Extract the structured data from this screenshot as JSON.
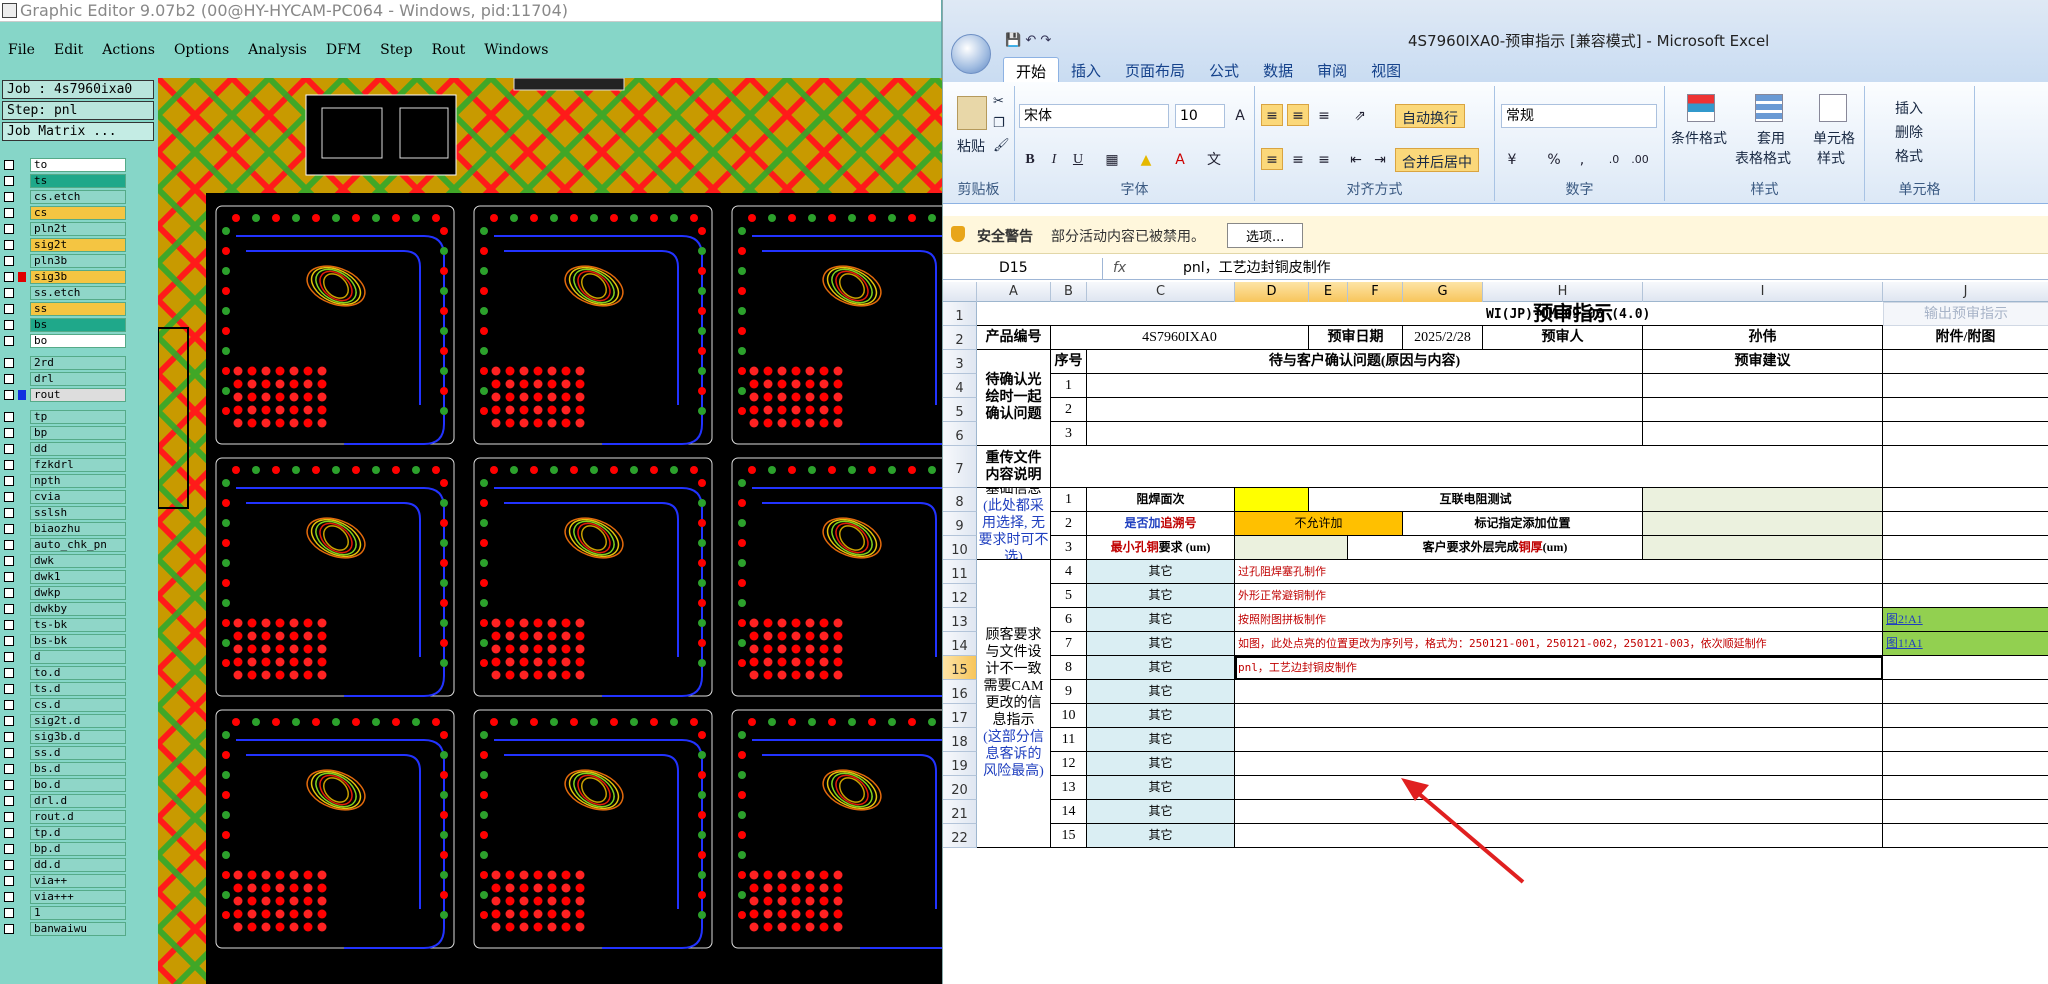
{
  "ge": {
    "title": "Graphic Editor 9.07b2 (00@HY-HYCAM-PC064 - Windows, pid:11704)",
    "menu": [
      "File",
      "Edit",
      "Actions",
      "Options",
      "Analysis",
      "DFM",
      "Step",
      "Rout",
      "Windows"
    ],
    "job": "Job : 4s7960ixa0",
    "step": "Step: pnl",
    "job_matrix": "Job Matrix ...",
    "layers": [
      {
        "n": "to",
        "c": "#ffffff"
      },
      {
        "n": "ts",
        "c": "#1fa88a"
      },
      {
        "n": "cs.etch",
        "c": "#8fd6c8"
      },
      {
        "n": "cs",
        "c": "#f4c542"
      },
      {
        "n": "pln2t",
        "c": "#8fd6c8"
      },
      {
        "n": "sig2t",
        "c": "#f4c542"
      },
      {
        "n": "pln3b",
        "c": "#8fd6c8"
      },
      {
        "n": "sig3b",
        "c": "#f4c542",
        "chip": "#e00000"
      },
      {
        "n": "ss.etch",
        "c": "#8fd6c8"
      },
      {
        "n": "ss",
        "c": "#f4c542"
      },
      {
        "n": "bs",
        "c": "#1fa88a"
      },
      {
        "n": "bo",
        "c": "#ffffff"
      },
      {
        "n": "2rd",
        "c": "#8fd6c8"
      },
      {
        "n": "drl",
        "c": "#8fd6c8"
      },
      {
        "n": "rout",
        "c": "#dddddd",
        "chip": "#1030e0"
      },
      {
        "n": "tp",
        "c": "#8fd6c8"
      },
      {
        "n": "bp",
        "c": "#8fd6c8"
      },
      {
        "n": "dd",
        "c": "#8fd6c8"
      },
      {
        "n": "fzkdrl",
        "c": "#8fd6c8"
      },
      {
        "n": "npth",
        "c": "#8fd6c8"
      },
      {
        "n": "cvia",
        "c": "#8fd6c8"
      },
      {
        "n": "sslsh",
        "c": "#8fd6c8"
      },
      {
        "n": "biaozhu",
        "c": "#8fd6c8"
      },
      {
        "n": "auto_chk_pn",
        "c": "#8fd6c8"
      },
      {
        "n": "dwk",
        "c": "#8fd6c8"
      },
      {
        "n": "dwk1",
        "c": "#8fd6c8"
      },
      {
        "n": "dwkp",
        "c": "#8fd6c8"
      },
      {
        "n": "dwkby",
        "c": "#8fd6c8"
      },
      {
        "n": "ts-bk",
        "c": "#8fd6c8"
      },
      {
        "n": "bs-bk",
        "c": "#8fd6c8"
      },
      {
        "n": "d",
        "c": "#8fd6c8"
      },
      {
        "n": "to.d",
        "c": "#8fd6c8"
      },
      {
        "n": "ts.d",
        "c": "#8fd6c8"
      },
      {
        "n": "cs.d",
        "c": "#8fd6c8"
      },
      {
        "n": "sig2t.d",
        "c": "#8fd6c8"
      },
      {
        "n": "sig3b.d",
        "c": "#8fd6c8"
      },
      {
        "n": "ss.d",
        "c": "#8fd6c8"
      },
      {
        "n": "bs.d",
        "c": "#8fd6c8"
      },
      {
        "n": "bo.d",
        "c": "#8fd6c8"
      },
      {
        "n": "drl.d",
        "c": "#8fd6c8"
      },
      {
        "n": "rout.d",
        "c": "#8fd6c8"
      },
      {
        "n": "tp.d",
        "c": "#8fd6c8"
      },
      {
        "n": "bp.d",
        "c": "#8fd6c8"
      },
      {
        "n": "dd.d",
        "c": "#8fd6c8"
      },
      {
        "n": "via++",
        "c": "#8fd6c8"
      },
      {
        "n": "via+++",
        "c": "#8fd6c8"
      },
      {
        "n": "1",
        "c": "#8fd6c8"
      },
      {
        "n": "banwaiwu",
        "c": "#8fd6c8"
      }
    ]
  },
  "xl": {
    "title": "4S7960IXA0-预审指示  [兼容模式] - Microsoft Excel",
    "tabs": [
      "开始",
      "插入",
      "页面布局",
      "公式",
      "数据",
      "审阅",
      "视图"
    ],
    "font_name": "宋体",
    "font_size": "10",
    "number_format": "常规",
    "labels": {
      "paste": "粘贴",
      "clipboard": "剪贴板",
      "font": "字体",
      "align": "对齐方式",
      "number": "数字",
      "style": "样式",
      "cells": "单元格",
      "wrap": "自动换行",
      "merge": "合并后居中",
      "cond": "条件格式",
      "table": "套用",
      "table2": "表格格式",
      "cellstyle": "单元格",
      "cellstyle2": "样式",
      "insert": "插入",
      "delete": "删除",
      "format": "格式"
    },
    "security": {
      "title": "安全警告",
      "msg": "部分活动内容已被禁用。",
      "btn": "选项..."
    },
    "namebox": "D15",
    "formula": "pnl，工艺边封铜皮制作",
    "columns": [
      "A",
      "B",
      "C",
      "D",
      "E",
      "F",
      "G",
      "H",
      "I",
      "J"
    ],
    "rows": [
      "1",
      "2",
      "3",
      "4",
      "5",
      "6",
      "7",
      "8",
      "9",
      "10",
      "11",
      "12",
      "13",
      "14",
      "15",
      "16",
      "17",
      "18",
      "19",
      "20",
      "21",
      "22"
    ],
    "sheet": {
      "heading": "预审指示",
      "doc_code": "WI(JP)-OM-09-06 (4.0)",
      "export_btn": "输出预审指示",
      "prod_label": "产品编号",
      "prod_no": "4S7960IXA0",
      "date_label": "预审日期",
      "date": "2025/2/28",
      "reviewer_label": "预审人",
      "reviewer": "孙伟",
      "attach": "附件/附图",
      "seq": "序号",
      "pending_hdr": "待与客户确认问题(原因与内容)",
      "suggest_hdr": "预审建议",
      "confirm_label": "待确认光绘时一起确认问题",
      "reupload_label": "重传文件内容说明",
      "basic_label": "基础信息",
      "basic_note": "(此处都采用选择, 无要求时可不选)",
      "mask_side": "阻焊面次",
      "interconnect": "互联电阻测试",
      "trace_no_a": "是否加",
      "trace_no_b": "追溯号",
      "not_allowed": "不允许加",
      "mark_pos": "标记指定添加位置",
      "min_hole_a": "最小孔铜",
      "min_hole_b": "要求 (um)",
      "cu_a": "客户要求外层完成",
      "cu_b": "铜厚",
      "cu_c": " (um)",
      "diff_label_a": "顾客要求与文件设计不一致需要CAM更改的信息指示",
      "diff_label_b": "(这部分信息客诉的风险最高)",
      "other": "其它",
      "items": [
        {
          "no": "1"
        },
        {
          "no": "2"
        },
        {
          "no": "3"
        },
        {
          "no": "4",
          "text": "过孔阻焊塞孔制作"
        },
        {
          "no": "5",
          "text": "外形正常避铜制作"
        },
        {
          "no": "6",
          "text": "按照附图拼板制作",
          "attach": "图2!A1"
        },
        {
          "no": "7",
          "text": "如图，此处点亮的位置更改为序列号，格式为：250121-001，250121-002，250121-003，依次顺延制作",
          "attach": "图1!A1"
        },
        {
          "no": "8",
          "text": "pnl，工艺边封铜皮制作"
        },
        {
          "no": "9"
        },
        {
          "no": "10"
        },
        {
          "no": "11"
        },
        {
          "no": "12"
        },
        {
          "no": "13"
        },
        {
          "no": "14"
        },
        {
          "no": "15"
        }
      ]
    }
  }
}
